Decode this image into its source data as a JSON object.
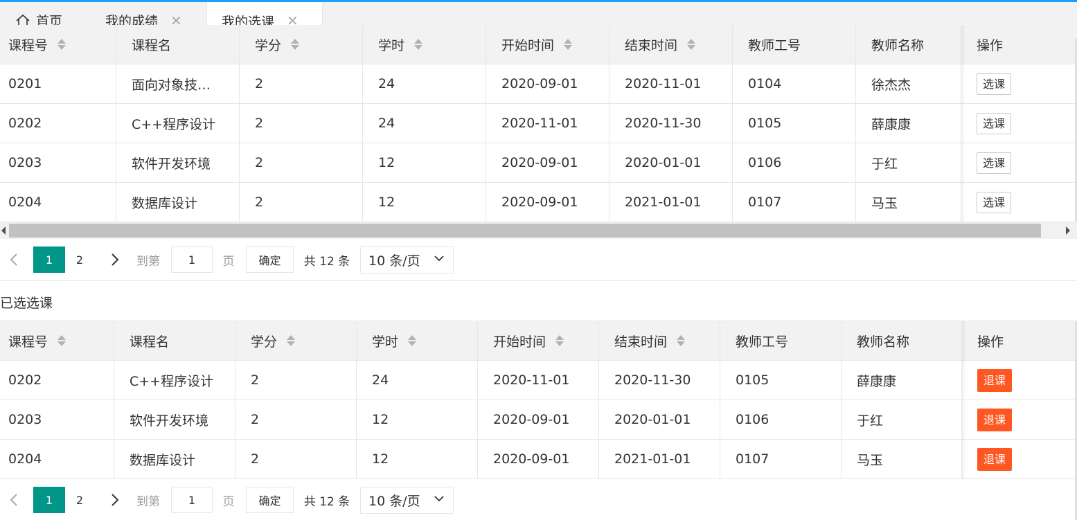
{
  "tabs": [
    {
      "label": "首页",
      "icon": "home-icon",
      "closable": false,
      "active": false
    },
    {
      "label": "我的成绩",
      "closable": true,
      "active": false
    },
    {
      "label": "我的选课",
      "closable": true,
      "active": true
    }
  ],
  "close_glyph": "✕",
  "available_courses": {
    "columns": [
      "课程号",
      "课程名",
      "学分",
      "学时",
      "开始时间",
      "结束时间",
      "教师工号",
      "教师名称",
      "操作"
    ],
    "rows": [
      {
        "id": "0201",
        "name": "面向对象技…",
        "credit": "2",
        "hours": "24",
        "start": "2020-09-01",
        "end": "2020-11-01",
        "teacher_id": "0104",
        "teacher": "徐杰杰",
        "action": "选课"
      },
      {
        "id": "0202",
        "name": "C++程序设计",
        "credit": "2",
        "hours": "24",
        "start": "2020-11-01",
        "end": "2020-11-30",
        "teacher_id": "0105",
        "teacher": "薛康康",
        "action": "选课"
      },
      {
        "id": "0203",
        "name": "软件开发环境",
        "credit": "2",
        "hours": "12",
        "start": "2020-09-01",
        "end": "2020-01-01",
        "teacher_id": "0106",
        "teacher": "于红",
        "action": "选课"
      },
      {
        "id": "0204",
        "name": "数据库设计",
        "credit": "2",
        "hours": "12",
        "start": "2020-09-01",
        "end": "2021-01-01",
        "teacher_id": "0107",
        "teacher": "马玉",
        "action": "选课"
      }
    ],
    "pager": {
      "current": "1",
      "next_page": "2",
      "goto_label": "到第",
      "page_input": "1",
      "page_unit": "页",
      "confirm": "确定",
      "total": "共 12 条",
      "page_size": "10 条/页"
    }
  },
  "selected_section_title": "已选选课",
  "selected_courses": {
    "columns": [
      "课程号",
      "课程名",
      "学分",
      "学时",
      "开始时间",
      "结束时间",
      "教师工号",
      "教师名称",
      "操作"
    ],
    "rows": [
      {
        "id": "0202",
        "name": "C++程序设计",
        "credit": "2",
        "hours": "24",
        "start": "2020-11-01",
        "end": "2020-11-30",
        "teacher_id": "0105",
        "teacher": "薛康康",
        "action": "退课"
      },
      {
        "id": "0203",
        "name": "软件开发环境",
        "credit": "2",
        "hours": "12",
        "start": "2020-09-01",
        "end": "2020-01-01",
        "teacher_id": "0106",
        "teacher": "于红",
        "action": "退课"
      },
      {
        "id": "0204",
        "name": "数据库设计",
        "credit": "2",
        "hours": "12",
        "start": "2020-09-01",
        "end": "2021-01-01",
        "teacher_id": "0107",
        "teacher": "马玉",
        "action": "退课"
      }
    ],
    "pager": {
      "current": "1",
      "next_page": "2",
      "goto_label": "到第",
      "page_input": "1",
      "page_unit": "页",
      "confirm": "确定",
      "total": "共 12 条",
      "page_size": "10 条/页"
    }
  },
  "colors": {
    "accent": "#1e9fff",
    "pager_active": "#009688",
    "drop_button": "#ff5722"
  }
}
